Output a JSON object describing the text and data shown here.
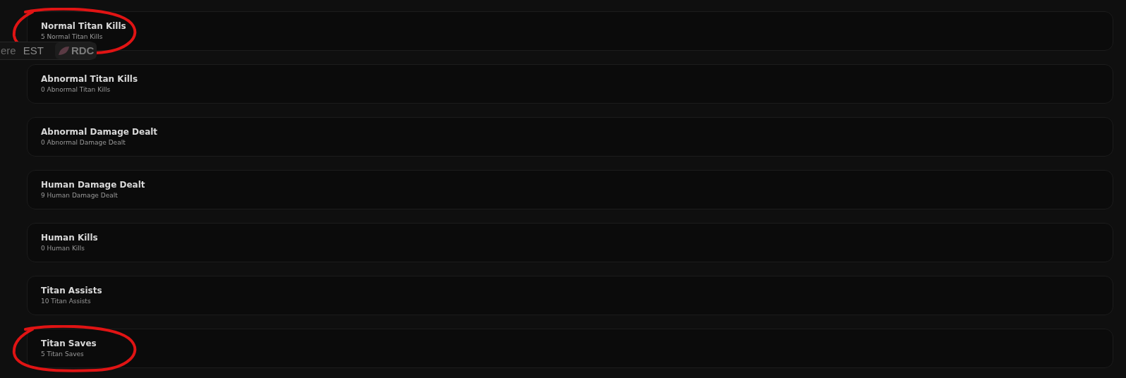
{
  "stats": [
    {
      "title": "Normal Titan Kills",
      "detail": "5 Normal Titan Kills",
      "highlighted": true
    },
    {
      "title": "Abnormal Titan Kills",
      "detail": "0 Abnormal Titan Kills",
      "highlighted": false
    },
    {
      "title": "Abnormal Damage Dealt",
      "detail": "0 Abnormal Damage Dealt",
      "highlighted": false
    },
    {
      "title": "Human Damage Dealt",
      "detail": "9 Human Damage Dealt",
      "highlighted": false
    },
    {
      "title": "Human Kills",
      "detail": "0 Human Kills",
      "highlighted": false
    },
    {
      "title": "Titan Assists",
      "detail": "10 Titan Assists",
      "highlighted": false
    },
    {
      "title": "Titan Saves",
      "detail": "5 Titan Saves",
      "highlighted": true
    }
  ],
  "background_bar": {
    "text_1": "ere",
    "text_2": "EST",
    "badge": "RDC"
  }
}
